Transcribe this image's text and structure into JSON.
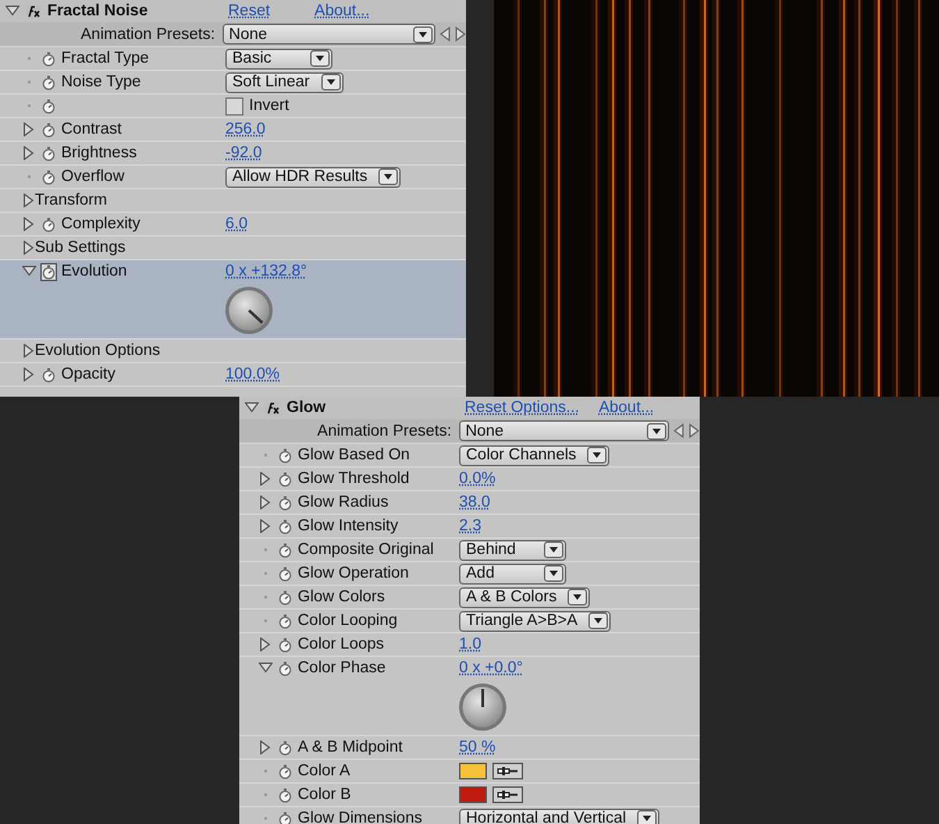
{
  "effects": [
    {
      "title": "Fractal Noise",
      "expanded": true,
      "links": [
        "Reset",
        "About..."
      ],
      "presets": {
        "label": "Animation Presets:",
        "value": "None"
      },
      "rows": [
        {
          "kind": "dropdown",
          "name": "Fractal Type",
          "value": "Basic",
          "selected": false
        },
        {
          "kind": "dropdown",
          "name": "Noise Type",
          "value": "Soft Linear",
          "selected": false
        },
        {
          "kind": "checkbox",
          "name": "",
          "value": "Invert",
          "checked": false,
          "selected": false
        },
        {
          "kind": "value",
          "name": "Contrast",
          "expanded": false,
          "value": "256.0",
          "selected": false
        },
        {
          "kind": "value",
          "name": "Brightness",
          "expanded": false,
          "value": "-92.0",
          "selected": false
        },
        {
          "kind": "dropdown",
          "name": "Overflow",
          "value": "Allow HDR Results",
          "selected": false
        },
        {
          "kind": "group",
          "name": "Transform",
          "expanded": false,
          "selected": false
        },
        {
          "kind": "value",
          "name": "Complexity",
          "expanded": false,
          "value": "6.0",
          "selected": false
        },
        {
          "kind": "group",
          "name": "Sub Settings",
          "expanded": false,
          "selected": false
        },
        {
          "kind": "angle",
          "name": "Evolution",
          "animated": true,
          "expanded": true,
          "value": "0 x +132.8°",
          "selected": true
        },
        {
          "kind": "group",
          "name": "Evolution Options",
          "expanded": false,
          "selected": false
        },
        {
          "kind": "value",
          "name": "Opacity",
          "expanded": false,
          "value": "100.0%",
          "selected": false
        }
      ]
    },
    {
      "title": "Glow",
      "expanded": true,
      "links": [
        "Reset Options...",
        "About..."
      ],
      "presets": {
        "label": "Animation Presets:",
        "value": "None"
      },
      "rows": [
        {
          "kind": "dropdown",
          "name": "Glow Based On",
          "value": "Color Channels",
          "selected": false
        },
        {
          "kind": "value",
          "name": "Glow Threshold",
          "expanded": false,
          "value": "0.0%",
          "selected": false
        },
        {
          "kind": "value",
          "name": "Glow Radius",
          "expanded": false,
          "value": "38.0",
          "selected": false
        },
        {
          "kind": "value",
          "name": "Glow Intensity",
          "expanded": false,
          "value": "2.3",
          "selected": false
        },
        {
          "kind": "dropdown",
          "name": "Composite Original",
          "value": "Behind",
          "selected": false
        },
        {
          "kind": "dropdown",
          "name": "Glow Operation",
          "value": "Add",
          "selected": false
        },
        {
          "kind": "dropdown",
          "name": "Glow Colors",
          "value": "A & B Colors",
          "selected": false
        },
        {
          "kind": "dropdown",
          "name": "Color Looping",
          "value": "Triangle A>B>A",
          "selected": false
        },
        {
          "kind": "value",
          "name": "Color Loops",
          "expanded": false,
          "value": "1.0",
          "selected": false
        },
        {
          "kind": "angle",
          "name": "Color Phase",
          "animated": false,
          "expanded": true,
          "value": "0 x +0.0°",
          "selected": false
        },
        {
          "kind": "value",
          "name": "A & B Midpoint",
          "expanded": false,
          "value": "50 %",
          "selected": false
        },
        {
          "kind": "color",
          "name": "Color A",
          "color": "#f4c13a",
          "selected": false
        },
        {
          "kind": "color",
          "name": "Color B",
          "color": "#bf1a0e",
          "selected": false
        },
        {
          "kind": "dropdown",
          "name": "Glow Dimensions",
          "value": "Horizontal and Vertical",
          "selected": false
        }
      ]
    }
  ]
}
